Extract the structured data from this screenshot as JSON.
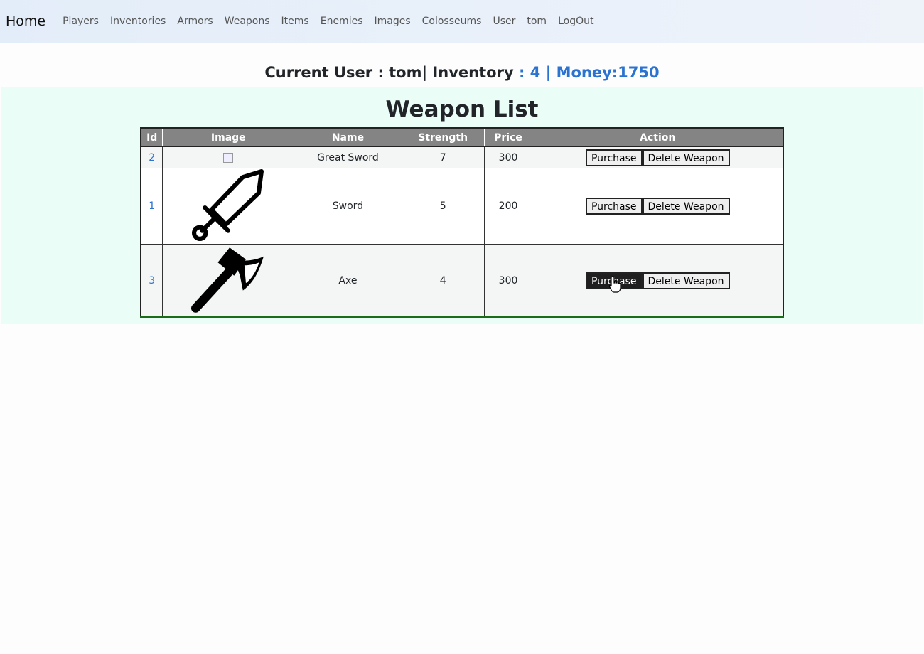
{
  "nav": {
    "brand": "Home",
    "links": [
      "Players",
      "Inventories",
      "Armors",
      "Weapons",
      "Items",
      "Enemies",
      "Images",
      "Colosseums",
      "User",
      "tom",
      "LogOut"
    ]
  },
  "status": {
    "prefix": "Current User : tom| Inventory",
    "accent": " : 4 | Money:1750"
  },
  "page_title": "Weapon List",
  "table": {
    "headers": [
      "Id",
      "Image",
      "Name",
      "Strength",
      "Price",
      "Action"
    ],
    "rows": [
      {
        "id": "2",
        "image": "broken-image",
        "name": "Great Sword",
        "strength": "7",
        "price": "300"
      },
      {
        "id": "1",
        "image": "sword-icon",
        "name": "Sword",
        "strength": "5",
        "price": "200"
      },
      {
        "id": "3",
        "image": "axe-icon",
        "name": "Axe",
        "strength": "4",
        "price": "300"
      }
    ],
    "purchase_label": "Purchase",
    "delete_label": "Delete Weapon"
  },
  "colors": {
    "accent": "#2a73d1",
    "header_bg": "#848484",
    "panel_bg": "#ebfdf7",
    "table_bottom_border": "#1a6b1a"
  }
}
